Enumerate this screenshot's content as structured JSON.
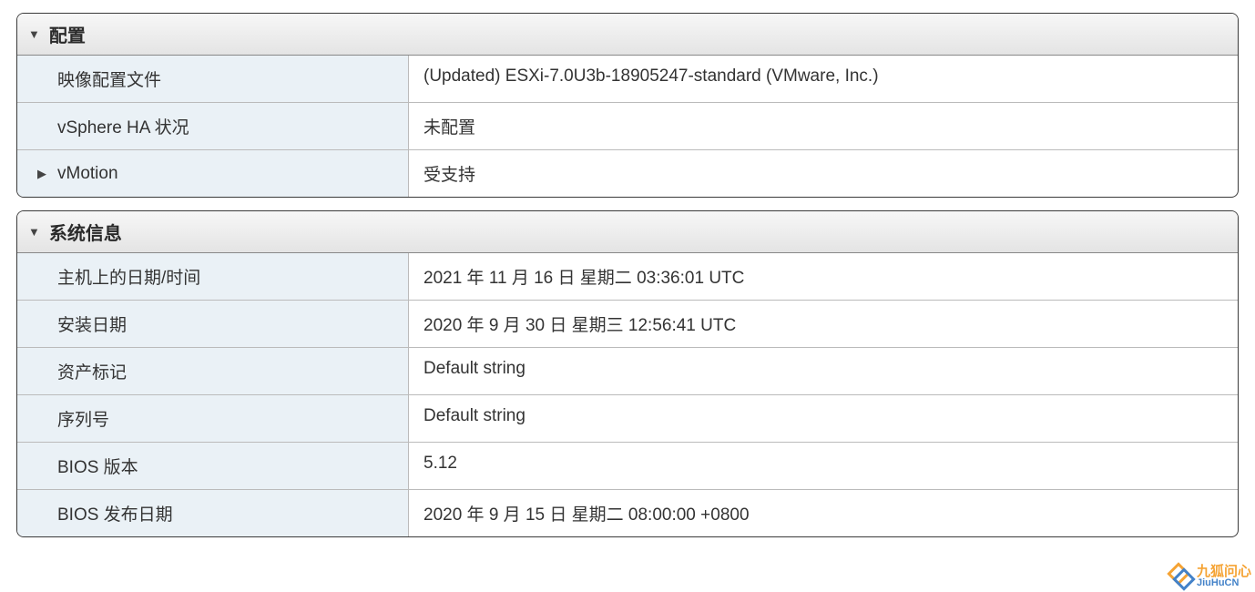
{
  "config": {
    "title": "配置",
    "rows": [
      {
        "label": "映像配置文件",
        "value": "(Updated) ESXi-7.0U3b-18905247-standard (VMware, Inc.)",
        "expandable": false
      },
      {
        "label": "vSphere HA 状况",
        "value": "未配置",
        "expandable": false
      },
      {
        "label": "vMotion",
        "value": "受支持",
        "expandable": true
      }
    ]
  },
  "sysinfo": {
    "title": "系统信息",
    "rows": [
      {
        "label": "主机上的日期/时间",
        "value": "2021 年 11 月 16 日 星期二 03:36:01 UTC"
      },
      {
        "label": "安装日期",
        "value": "2020 年 9 月 30 日 星期三 12:56:41 UTC"
      },
      {
        "label": "资产标记",
        "value": "Default string"
      },
      {
        "label": "序列号",
        "value": "Default string"
      },
      {
        "label": "BIOS 版本",
        "value": "5.12"
      },
      {
        "label": "BIOS 发布日期",
        "value": "2020 年 9 月 15 日 星期二 08:00:00 +0800"
      }
    ]
  },
  "watermark": {
    "top": "九狐问心",
    "bottom": "JiuHuCN"
  }
}
